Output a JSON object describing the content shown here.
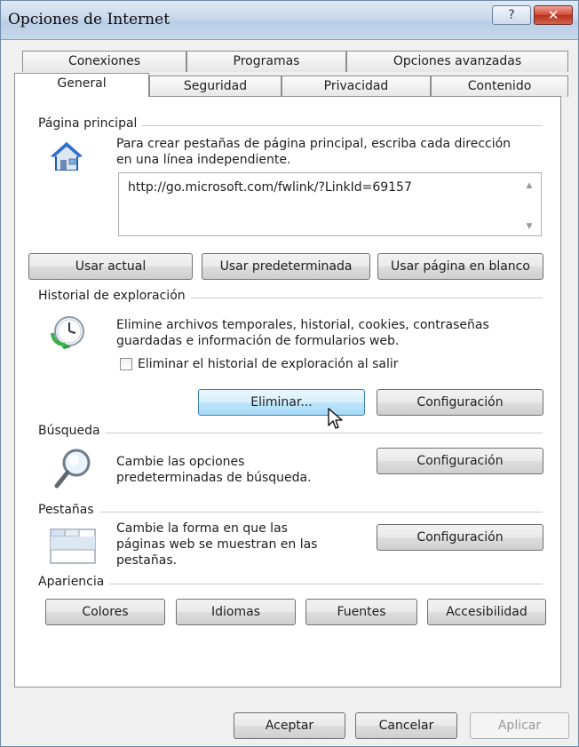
{
  "window": {
    "title": "Opciones de Internet",
    "help_label": "?",
    "close_label": "✕"
  },
  "tabs": {
    "row_back": [
      "Conexiones",
      "Programas",
      "Opciones avanzadas"
    ],
    "row_front": [
      "General",
      "Seguridad",
      "Privacidad",
      "Contenido"
    ],
    "active": "General"
  },
  "home_page": {
    "section_label": "Página principal",
    "description_line1": "Para crear pestañas de página principal, escriba cada dirección",
    "description_line2": "en una línea independiente.",
    "url": "http://go.microsoft.com/fwlink/?LinkId=69157",
    "buttons": {
      "use_current": "Usar actual",
      "use_default": "Usar predeterminada",
      "use_blank": "Usar página en blanco"
    },
    "icon": "home-icon"
  },
  "browsing_history": {
    "section_label": "Historial de exploración",
    "description_line1": "Elimine archivos temporales, historial, cookies, contraseñas",
    "description_line2": "guardadas e información de formularios web.",
    "checkbox_label": "Eliminar el historial de exploración al salir",
    "checkbox_checked": false,
    "buttons": {
      "delete": "Eliminar...",
      "settings": "Configuración"
    },
    "icon": "history-clock-icon"
  },
  "search": {
    "section_label": "Búsqueda",
    "description_line1": "Cambie las opciones",
    "description_line2": "predeterminadas de búsqueda.",
    "button": "Configuración",
    "icon": "magnifier-icon"
  },
  "tabs_section": {
    "section_label": "Pestañas",
    "description_line1": "Cambie la forma en que las",
    "description_line2": "páginas web se muestran en las",
    "description_line3": "pestañas.",
    "button": "Configuración",
    "icon": "tabbed-window-icon"
  },
  "appearance": {
    "section_label": "Apariencia",
    "buttons": {
      "colors": "Colores",
      "languages": "Idiomas",
      "fonts": "Fuentes",
      "accessibility": "Accesibilidad"
    }
  },
  "footer": {
    "ok": "Aceptar",
    "cancel": "Cancelar",
    "apply": "Aplicar"
  },
  "colors": {
    "accent_hover": "#bee6fd",
    "close_red": "#c7432f"
  }
}
